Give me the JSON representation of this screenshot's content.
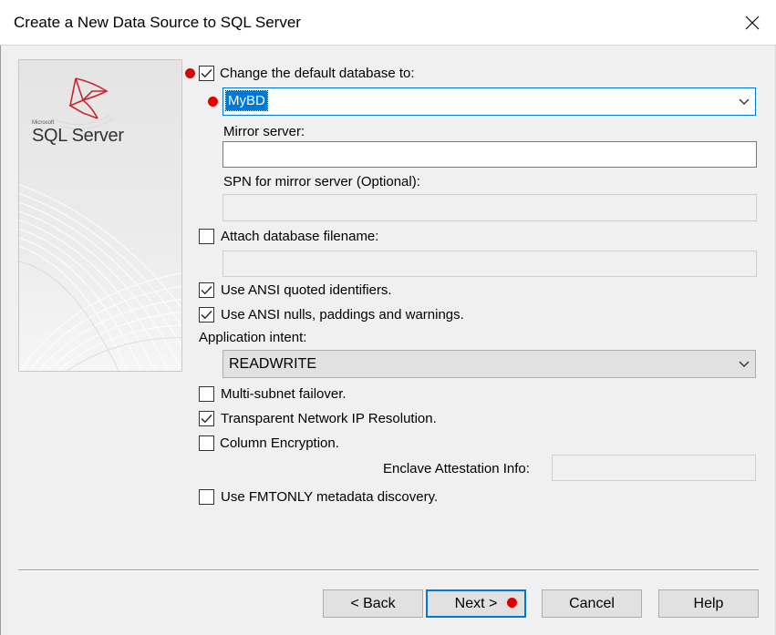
{
  "window": {
    "title": "Create a New Data Source to SQL Server"
  },
  "logo": {
    "brand_small": "Microsoft",
    "brand": "SQL Server"
  },
  "options": {
    "change_default_db": {
      "label": "Change the default database to:",
      "checked": true
    },
    "default_db_value": "MyBD",
    "mirror_server": {
      "label": "Mirror server:",
      "value": ""
    },
    "spn_mirror": {
      "label": "SPN for mirror server (Optional):",
      "value": ""
    },
    "attach_db": {
      "label": "Attach database filename:",
      "checked": false,
      "value": ""
    },
    "ansi_quoted": {
      "label": "Use ANSI quoted identifiers.",
      "checked": true
    },
    "ansi_nulls": {
      "label": "Use ANSI nulls, paddings and warnings.",
      "checked": true
    },
    "app_intent": {
      "label": "Application intent:",
      "value": "READWRITE"
    },
    "multi_subnet": {
      "label": "Multi-subnet failover.",
      "checked": false
    },
    "tnir": {
      "label": "Transparent Network IP Resolution.",
      "checked": true
    },
    "column_encryption": {
      "label": "Column Encryption.",
      "checked": false
    },
    "enclave": {
      "label": "Enclave Attestation Info:",
      "value": ""
    },
    "fmtonly": {
      "label": "Use FMTONLY metadata discovery.",
      "checked": false
    }
  },
  "buttons": {
    "back": "< Back",
    "next": "Next >",
    "cancel": "Cancel",
    "help": "Help"
  },
  "colors": {
    "accent": "#0078d7",
    "marker": "#e00000",
    "logo_red": "#c8262d"
  },
  "icons": {
    "close": "close-icon",
    "check": "checkmark-icon",
    "dropdown": "chevron-down-icon",
    "logo": "sql-server-logo-icon"
  }
}
